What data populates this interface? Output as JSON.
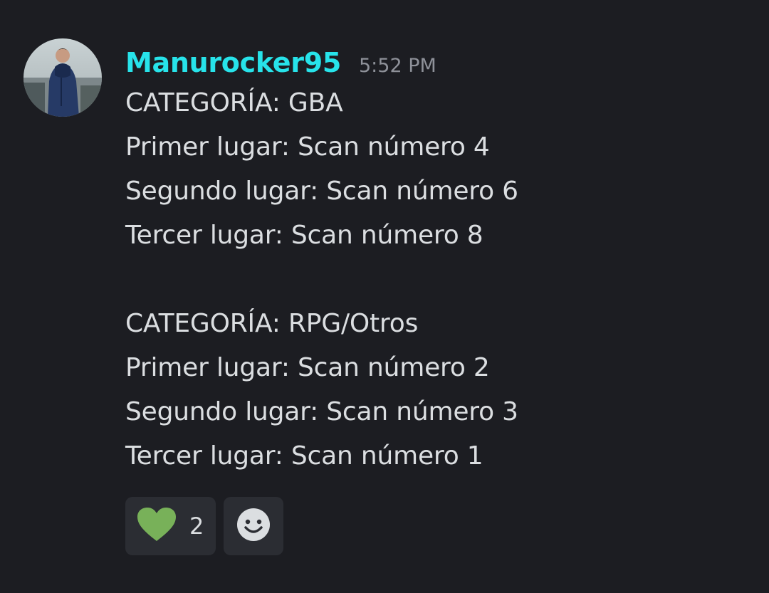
{
  "message": {
    "username": "Manurocker95",
    "username_color": "#27e3ea",
    "timestamp": "5:52 PM",
    "lines": [
      "CATEGORÍA: GBA",
      "Primer lugar: Scan número 4",
      "Segundo lugar: Scan número 6",
      "Tercer lugar: Scan número 8",
      "",
      "CATEGORÍA: RPG/Otros",
      "Primer lugar: Scan número 2",
      "Segundo lugar: Scan número 3",
      "Tercer lugar: Scan número 1"
    ]
  },
  "reactions": [
    {
      "icon": "green-heart-icon",
      "count": "2",
      "color": "#78b159"
    }
  ],
  "add_reaction": {
    "icon": "smiley-add-reaction-icon"
  },
  "colors": {
    "background": "#1c1d22",
    "text": "#dbdee1",
    "timestamp": "#8e9199",
    "reaction_bg": "#2b2d33"
  }
}
